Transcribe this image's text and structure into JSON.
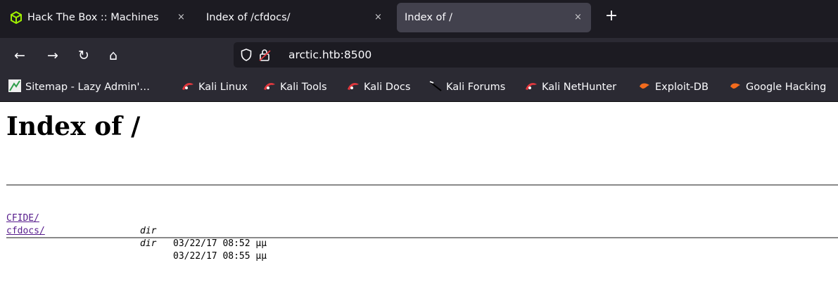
{
  "browser": {
    "tabs": [
      {
        "title": "Hack The Box :: Machines",
        "close": "×",
        "icon": "htb-cube-icon",
        "active": false
      },
      {
        "title": "Index of /cfdocs/",
        "close": "×",
        "active": false
      },
      {
        "title": "Index of /",
        "close": "×",
        "active": true
      }
    ],
    "new_tab_label": "+",
    "nav": {
      "back": "←",
      "forward": "→",
      "reload": "↻",
      "home": "⌂"
    },
    "url": "arctic.htb:8500",
    "bookmarks": [
      {
        "label": "Sitemap - Lazy Admin'…",
        "icon": "sitemap-favicon"
      },
      {
        "label": "Kali Linux",
        "icon": "kali-icon"
      },
      {
        "label": "Kali Tools",
        "icon": "kali-icon"
      },
      {
        "label": "Kali Docs",
        "icon": "kali-icon"
      },
      {
        "label": "Kali Forums",
        "icon": "kali-dragon-icon"
      },
      {
        "label": "Kali NetHunter",
        "icon": "kali-icon"
      },
      {
        "label": "Exploit-DB",
        "icon": "exploit-db-icon"
      },
      {
        "label": "Google Hacking",
        "icon": "exploit-db-icon"
      }
    ]
  },
  "page": {
    "title": "Index of /",
    "entries": [
      {
        "name": "CFIDE/",
        "type": "dir",
        "date": "03/22/17 08:52 μμ"
      },
      {
        "name": "cfdocs/",
        "type": "dir",
        "date": "03/22/17 08:55 μμ"
      }
    ]
  },
  "colors": {
    "tabbar": "#1c1b22",
    "toolbar": "#2b2a33",
    "active_tab": "#42414d",
    "link": "#551a8b",
    "htb_green": "#9fef00",
    "kali_red": "#e0383e",
    "exploit_orange": "#f26b1d"
  }
}
